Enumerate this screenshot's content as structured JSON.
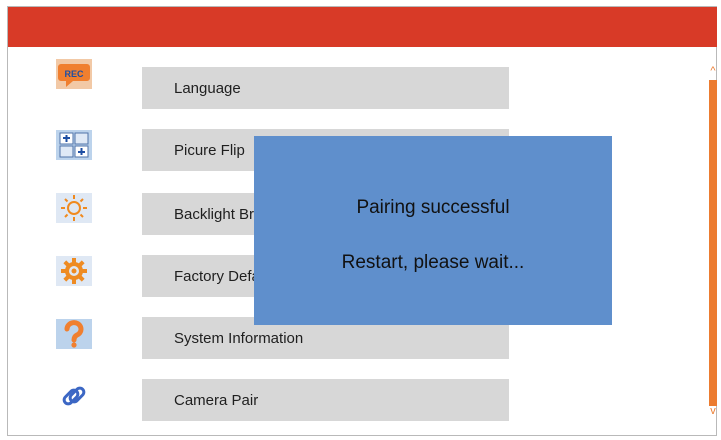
{
  "colors": {
    "title_bar": "#d83a27",
    "menu_item": "#d7d7d7",
    "dialog": "#5f8fcc",
    "scrollbar": "#ec7c30"
  },
  "menu": {
    "items": [
      {
        "label": "Language",
        "icon": "rec-speech-bubble-icon"
      },
      {
        "label": "Picure Flip",
        "icon": "picture-flip-icon"
      },
      {
        "label": "Backlight Brightness",
        "icon": "sun-icon"
      },
      {
        "label": "Factory Default",
        "icon": "gear-icon"
      },
      {
        "label": "System Information",
        "icon": "question-mark-icon"
      },
      {
        "label": "Camera Pair",
        "icon": "link-icon"
      }
    ]
  },
  "scrollbar": {
    "up_arrow": "^",
    "down_arrow": "v"
  },
  "dialog": {
    "line1": "Pairing successful",
    "line2": "Restart, please wait..."
  }
}
